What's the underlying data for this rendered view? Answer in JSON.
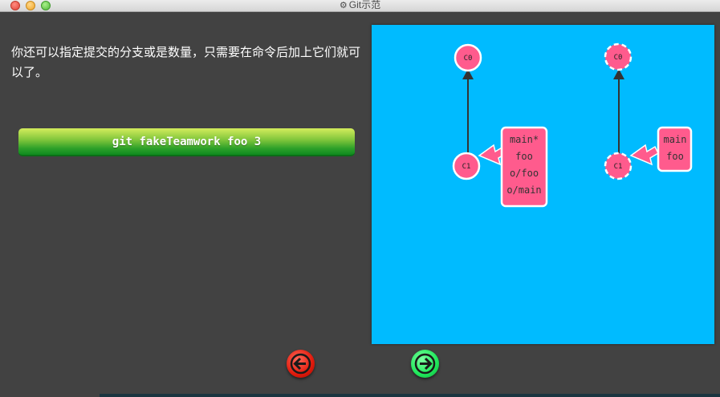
{
  "window": {
    "title": "Git示范",
    "icon": "gear-icon"
  },
  "description": "你还可以指定提交的分支或是数量，只需要在命令后加上它们就可以了。",
  "command_button": {
    "label": "git fakeTeamwork foo 3"
  },
  "colors": {
    "background": "#424242",
    "canvas": "#00bbff",
    "commit_fill": "#ff5b8d",
    "branch_fill": "#ff5b8d",
    "prev_button": "#e01a0c",
    "next_button": "#1ee85a"
  },
  "visualization": {
    "left_repo": {
      "commits": [
        "C0",
        "C1"
      ],
      "branch_labels": [
        "main*",
        "foo",
        "o/foo",
        "o/main"
      ]
    },
    "right_repo": {
      "commits": [
        "C0",
        "C1"
      ],
      "branch_labels": [
        "main",
        "foo"
      ]
    }
  },
  "navigation": {
    "prev": "arrow-left-icon",
    "next": "arrow-right-icon"
  }
}
